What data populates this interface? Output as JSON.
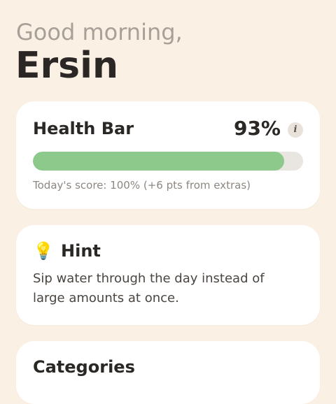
{
  "header": {
    "greeting": "Good morning,",
    "user_name": "Ersin"
  },
  "health_card": {
    "title": "Health Bar",
    "percent_label": "93%",
    "progress_fraction": 0.93,
    "info_icon": "info-icon",
    "info_glyph": "i",
    "subtext": "Today's score: 100% (+6 pts from extras)"
  },
  "hint_card": {
    "icon": "lightbulb-icon",
    "icon_glyph": "💡",
    "title": "Hint",
    "text": "Sip water through the day instead of large amounts at once."
  },
  "categories_card": {
    "title": "Categories"
  },
  "colors": {
    "background": "#faf0e4",
    "card": "#ffffff",
    "progress_fill": "#8ec98c",
    "progress_track": "#e9e5e0",
    "greeting_text": "#a8a098",
    "primary_text": "#2a2724"
  }
}
